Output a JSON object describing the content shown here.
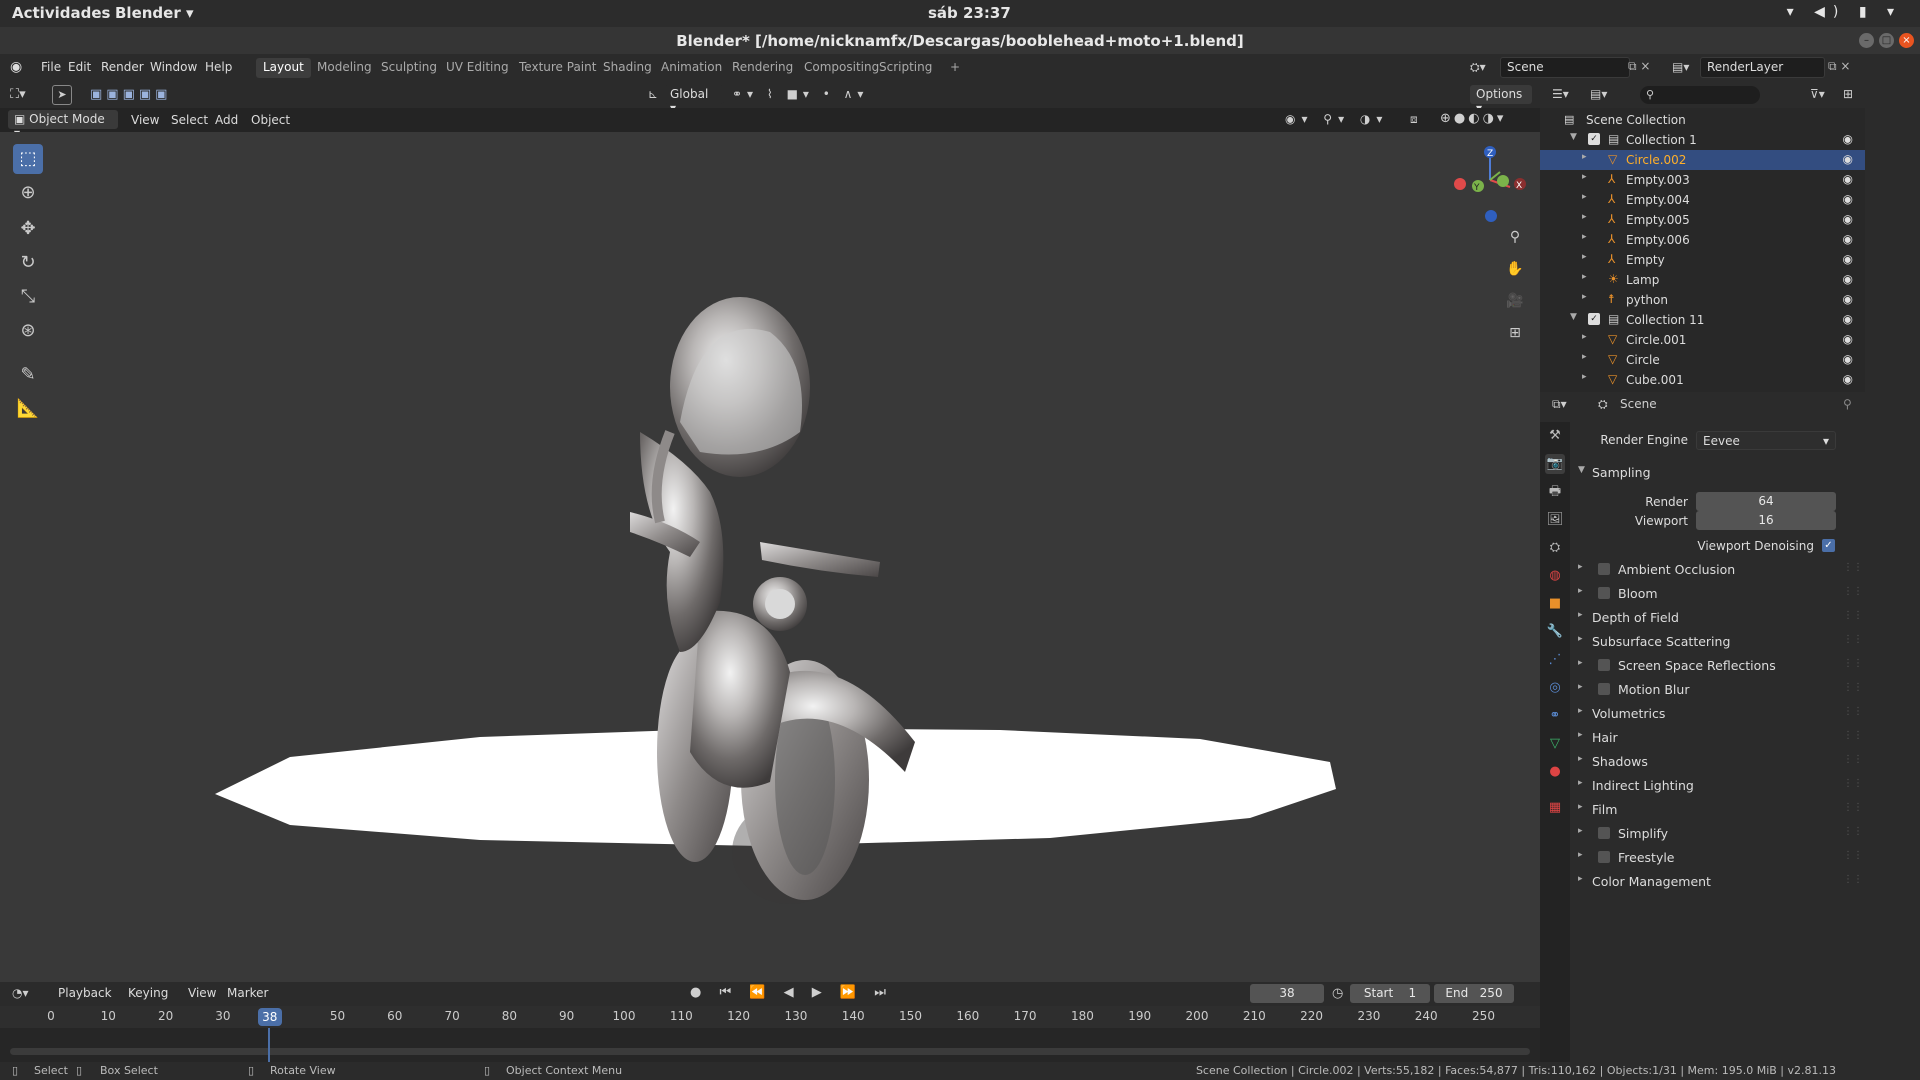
{
  "gnome": {
    "activities": "Actividades",
    "app": "Blender ▾",
    "clock": "sáb 23:37"
  },
  "title": "Blender* [/home/nicknamfx/Descargas/booblehead+moto+1.blend]",
  "menus": [
    "File",
    "Edit",
    "Render",
    "Window",
    "Help"
  ],
  "workspaces": [
    "Layout",
    "Modeling",
    "Sculpting",
    "UV Editing",
    "Texture Paint",
    "Shading",
    "Animation",
    "Rendering",
    "Compositing",
    "Scripting",
    "+"
  ],
  "scene_name": "Scene",
  "render_layer": "RenderLayer",
  "viewport": {
    "transform": "Global",
    "options": "Options ▾",
    "mode": "Object Mode",
    "menus": [
      "View",
      "Select",
      "Add",
      "Object"
    ]
  },
  "gizmo": {
    "x": "X",
    "y": "Y",
    "z": "Z"
  },
  "timeline": {
    "menus": [
      "Playback",
      "Keying",
      "View",
      "Marker"
    ],
    "current": "38",
    "start_label": "Start",
    "start": "1",
    "end_label": "End",
    "end": "250",
    "ticks": [
      "0",
      "10",
      "20",
      "30",
      "38",
      "50",
      "60",
      "70",
      "80",
      "90",
      "100",
      "110",
      "120",
      "130",
      "140",
      "150",
      "160",
      "170",
      "180",
      "190",
      "200",
      "210",
      "220",
      "230",
      "240",
      "250"
    ]
  },
  "statusbar": {
    "select": "Select",
    "box_select": "Box Select",
    "rotate": "Rotate View",
    "context": "Object Context Menu",
    "stats": "Scene Collection | Circle.002 | Verts:55,182 | Faces:54,877 | Tris:110,162 | Objects:1/31 | Mem: 195.0 MiB | v2.81.13"
  },
  "outliner": {
    "root": "Scene Collection",
    "rows": [
      {
        "name": "Collection 1",
        "indent": 1,
        "type": "collection"
      },
      {
        "name": "Circle.002",
        "indent": 2,
        "type": "mesh",
        "selected": true
      },
      {
        "name": "Empty.003",
        "indent": 2,
        "type": "empty"
      },
      {
        "name": "Empty.004",
        "indent": 2,
        "type": "empty"
      },
      {
        "name": "Empty.005",
        "indent": 2,
        "type": "empty"
      },
      {
        "name": "Empty.006",
        "indent": 2,
        "type": "empty"
      },
      {
        "name": "Empty",
        "indent": 2,
        "type": "empty"
      },
      {
        "name": "Lamp",
        "indent": 2,
        "type": "light"
      },
      {
        "name": "python",
        "indent": 2,
        "type": "armature"
      },
      {
        "name": "Collection 11",
        "indent": 1,
        "type": "collection"
      },
      {
        "name": "Circle.001",
        "indent": 2,
        "type": "mesh"
      },
      {
        "name": "Circle",
        "indent": 2,
        "type": "mesh"
      },
      {
        "name": "Cube.001",
        "indent": 2,
        "type": "mesh"
      }
    ]
  },
  "properties": {
    "context": "Scene",
    "render_engine_label": "Render Engine",
    "render_engine": "Eevee",
    "sampling": "Sampling",
    "render_label": "Render",
    "render_value": "64",
    "viewport_label": "Viewport",
    "viewport_value": "16",
    "denoise_label": "Viewport Denoising",
    "panels": [
      {
        "name": "Ambient Occlusion",
        "cb": true
      },
      {
        "name": "Bloom",
        "cb": true
      },
      {
        "name": "Depth of Field",
        "cb": false
      },
      {
        "name": "Subsurface Scattering",
        "cb": false
      },
      {
        "name": "Screen Space Reflections",
        "cb": true
      },
      {
        "name": "Motion Blur",
        "cb": true
      },
      {
        "name": "Volumetrics",
        "cb": false
      },
      {
        "name": "Hair",
        "cb": false
      },
      {
        "name": "Shadows",
        "cb": false
      },
      {
        "name": "Indirect Lighting",
        "cb": false
      },
      {
        "name": "Film",
        "cb": false
      },
      {
        "name": "Simplify",
        "cb": true
      },
      {
        "name": "Freestyle",
        "cb": true
      },
      {
        "name": "Color Management",
        "cb": false
      }
    ]
  },
  "colors": {
    "accent": "#4b6fa8",
    "selected_text": "#ffaf29",
    "viewport_bg": "#393939"
  }
}
